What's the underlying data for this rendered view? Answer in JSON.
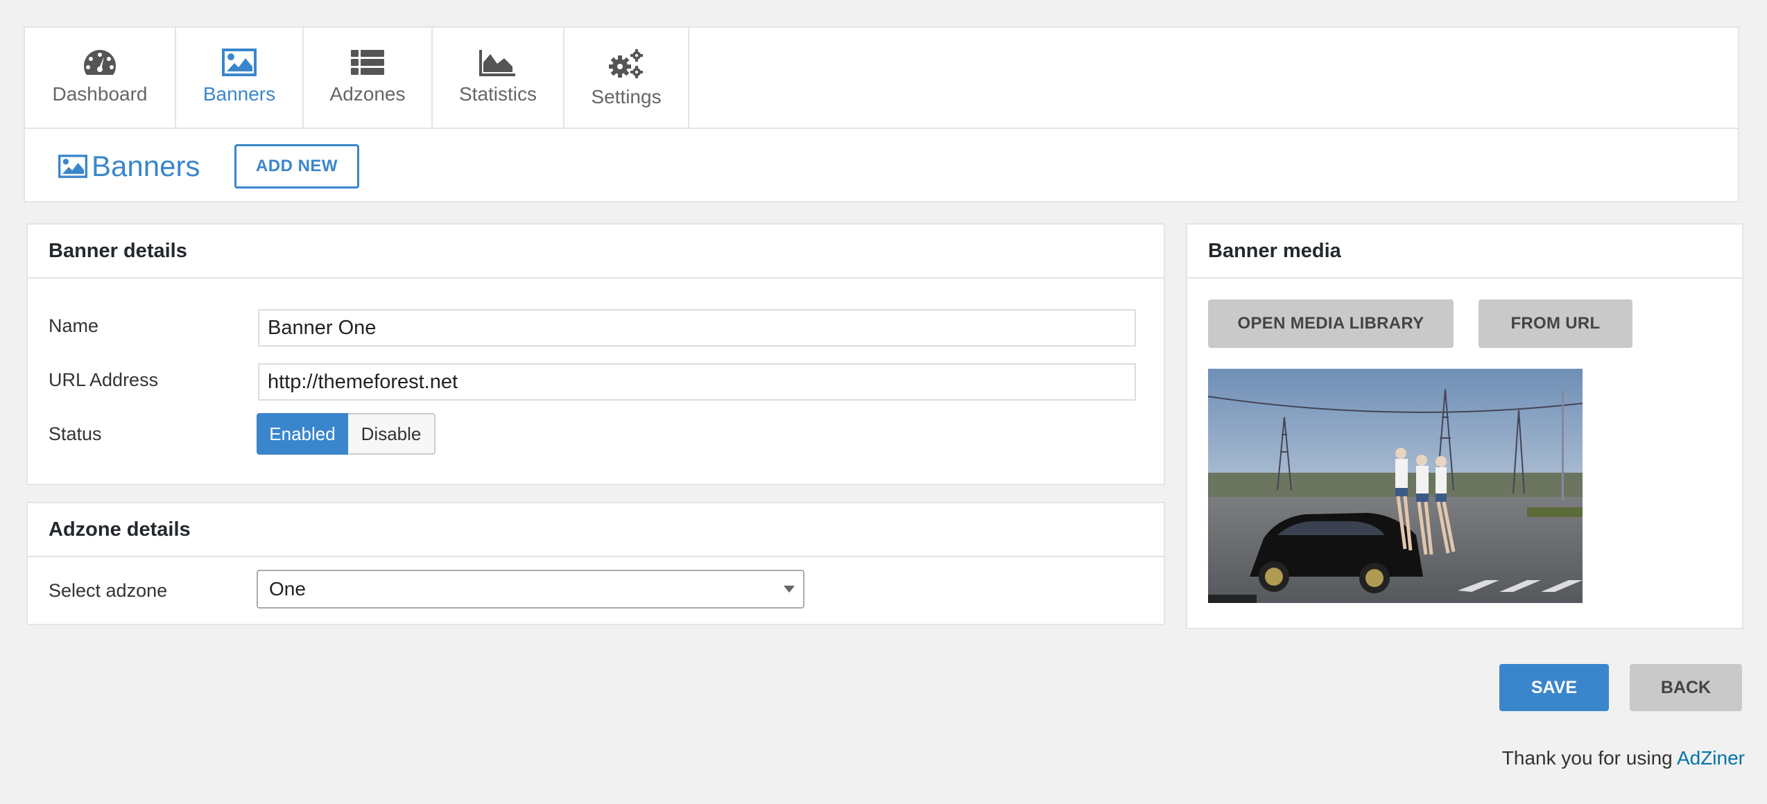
{
  "nav": {
    "tabs": [
      {
        "label": "Dashboard",
        "icon": "dashboard-gauge-icon",
        "active": false
      },
      {
        "label": "Banners",
        "icon": "image-icon",
        "active": true
      },
      {
        "label": "Adzones",
        "icon": "list-icon",
        "active": false
      },
      {
        "label": "Statistics",
        "icon": "area-chart-icon",
        "active": false
      },
      {
        "label": "Settings",
        "icon": "gears-icon",
        "active": false
      }
    ]
  },
  "header": {
    "title": "Banners",
    "title_icon": "image-icon",
    "add_new_label": "ADD NEW"
  },
  "banner_details": {
    "heading": "Banner details",
    "name_label": "Name",
    "name_value": "Banner One",
    "url_label": "URL Address",
    "url_value": "http://themeforest.net",
    "status_label": "Status",
    "status_enabled": "Enabled",
    "status_disable": "Disable"
  },
  "adzone_details": {
    "heading": "Adzone details",
    "select_label": "Select adzone",
    "selected": "One"
  },
  "banner_media": {
    "heading": "Banner media",
    "open_library_label": "OPEN MEDIA LIBRARY",
    "from_url_label": "FROM URL"
  },
  "actions": {
    "save_label": "SAVE",
    "back_label": "BACK"
  },
  "footer": {
    "text": "Thank you for using",
    "link": "AdZiner"
  },
  "colors": {
    "accent": "#3a86cc",
    "background": "#f1f1f1",
    "button_gray": "#c9c9c9"
  }
}
